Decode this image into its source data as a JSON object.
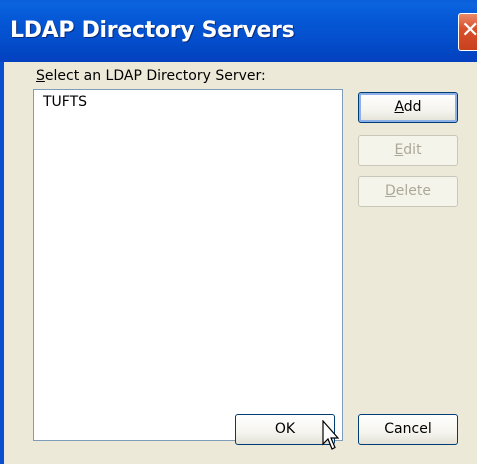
{
  "window": {
    "title": "LDAP Directory Servers",
    "close_glyph": "✕"
  },
  "main": {
    "prompt_label": "Select an LDAP Directory Server:",
    "servers": [
      "TUFTS"
    ]
  },
  "buttons": {
    "add": "Add",
    "edit": "Edit",
    "delete": "Delete",
    "ok": "OK",
    "cancel": "Cancel"
  }
}
